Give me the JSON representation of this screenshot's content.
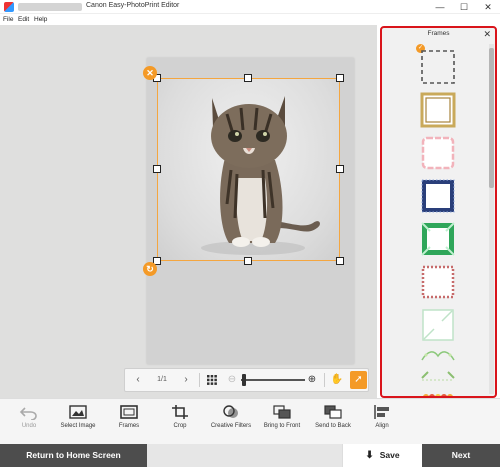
{
  "window": {
    "title": "Canon Easy-PhotoPrint Editor",
    "controls": {
      "minimize": "—",
      "maximize": "☐",
      "close": "✕"
    }
  },
  "menu": [
    "File",
    "Edit",
    "Help"
  ],
  "canvas": {
    "page_indicator": "1/1",
    "selected_image": "kitten-photo",
    "zoom_level": 0.05
  },
  "frames_panel": {
    "title": "Frames",
    "close_label": "✕",
    "frames": [
      {
        "name": "dashed-frame",
        "selected": true
      },
      {
        "name": "gold-ornate-frame",
        "selected": false
      },
      {
        "name": "pink-floral-frame",
        "selected": false
      },
      {
        "name": "blue-beaded-frame",
        "selected": false
      },
      {
        "name": "green-geometric-frame",
        "selected": false
      },
      {
        "name": "red-dotted-frame",
        "selected": false
      },
      {
        "name": "mint-corner-frame",
        "selected": false
      },
      {
        "name": "green-vine-frame",
        "selected": false
      },
      {
        "name": "leaf-corner-frame",
        "selected": false
      },
      {
        "name": "floral-garland-frame",
        "selected": false
      }
    ]
  },
  "toolbar": {
    "undo": "Undo",
    "select_image": "Select Image",
    "frames": "Frames",
    "crop": "Crop",
    "creative_filters": "Creative Filters",
    "bring_to_front": "Bring to Front",
    "send_to_back": "Send to Back",
    "align": "Align"
  },
  "bottom": {
    "home_label": "Return to Home Screen",
    "save_label": "Save",
    "next_label": "Next"
  },
  "colors": {
    "accent": "#f49a27",
    "panel_highlight": "#d9141b",
    "dark_button": "#4d4d4d"
  }
}
